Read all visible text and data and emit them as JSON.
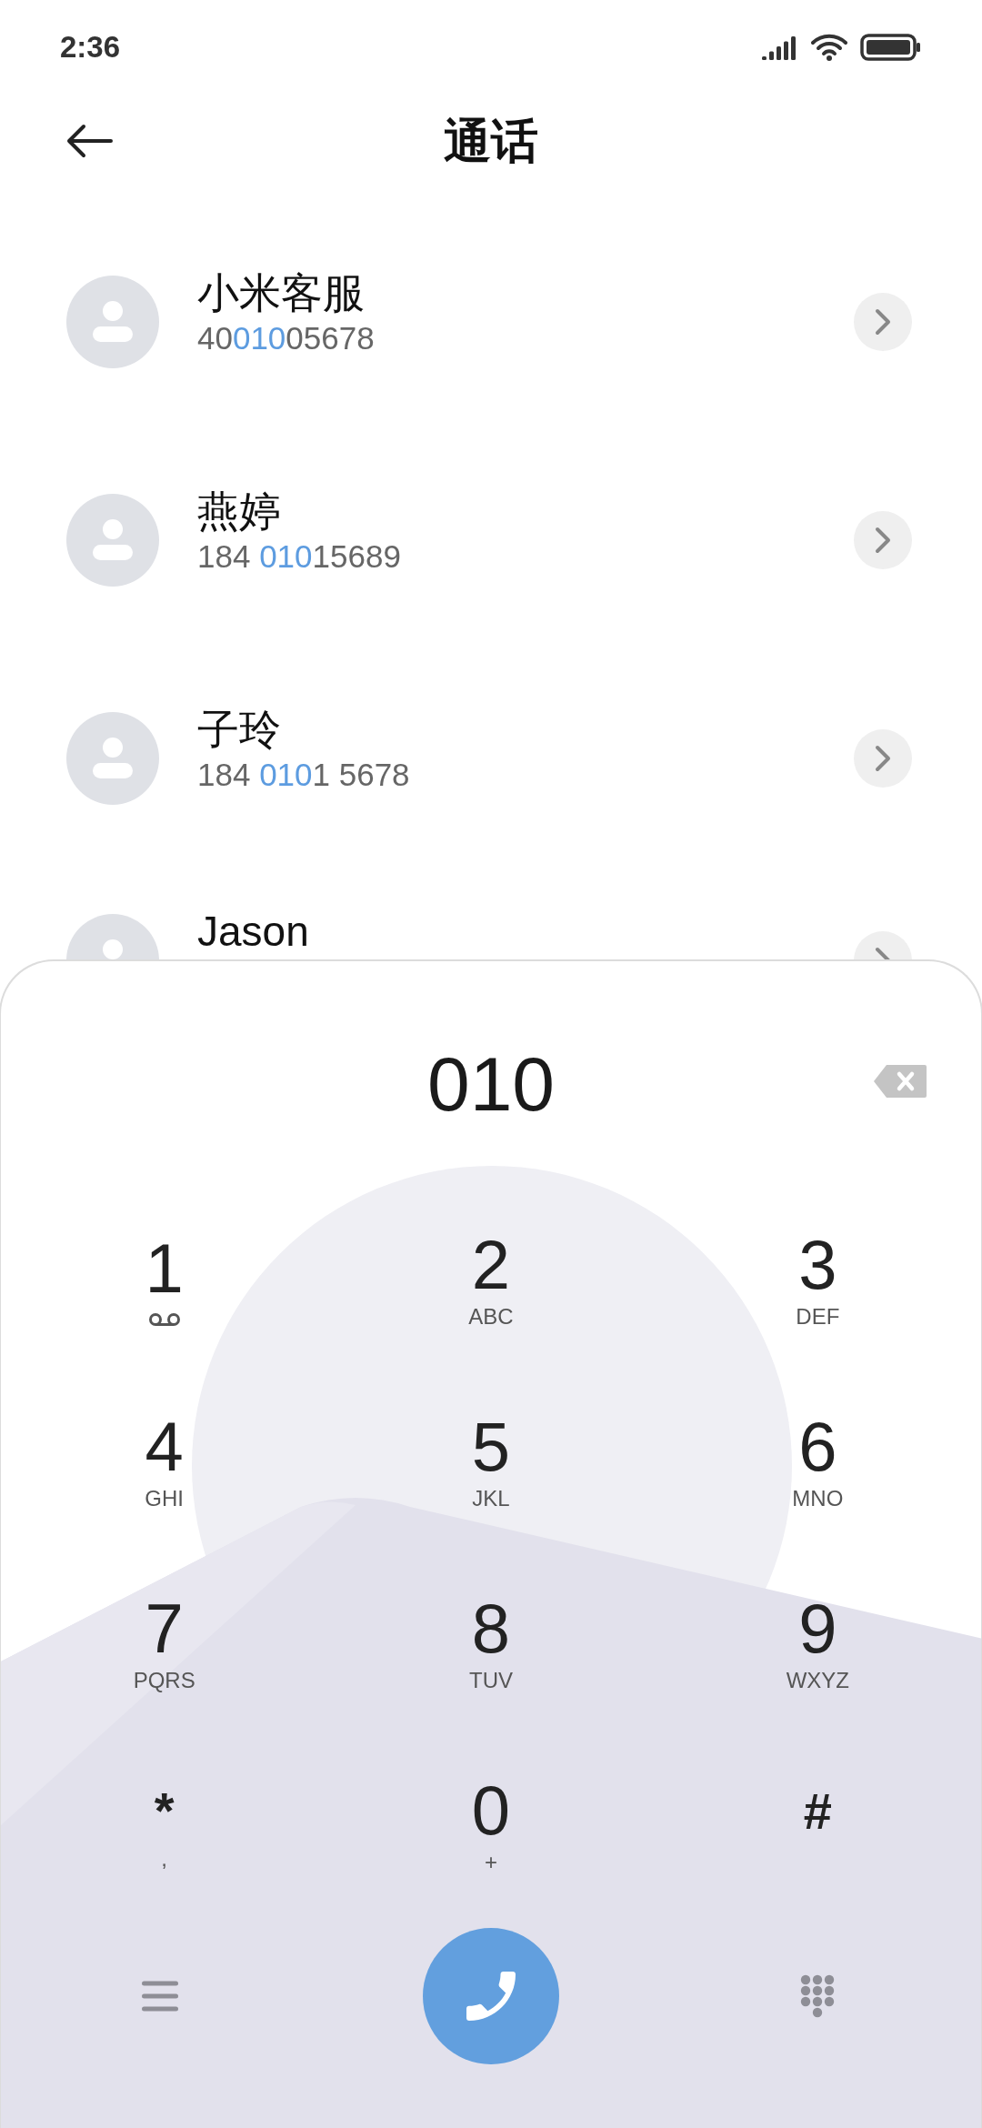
{
  "status_bar": {
    "time": "2:36"
  },
  "header": {
    "title": "通话"
  },
  "contacts": [
    {
      "name": "小米客服",
      "number": {
        "before": "40",
        "match": "010",
        "after": "05678"
      }
    },
    {
      "name": "燕婷",
      "number": {
        "before": "184 ",
        "match": "010",
        "after": "15689"
      }
    },
    {
      "name": "子玲",
      "number": {
        "before": "184 ",
        "match": "010",
        "after": "1 5678"
      }
    },
    {
      "name": "Jason"
    }
  ],
  "dialer": {
    "input": "010",
    "keys": [
      {
        "digit": "1",
        "kind": "voicemail"
      },
      {
        "digit": "2",
        "letters": "ABC"
      },
      {
        "digit": "3",
        "letters": "DEF"
      },
      {
        "digit": "4",
        "letters": "GHI"
      },
      {
        "digit": "5",
        "letters": "JKL"
      },
      {
        "digit": "6",
        "letters": "MNO"
      },
      {
        "digit": "7",
        "letters": "PQRS"
      },
      {
        "digit": "8",
        "letters": "TUV"
      },
      {
        "digit": "9",
        "letters": "WXYZ"
      },
      {
        "digit": "*",
        "letters": ",",
        "kind": "symbol"
      },
      {
        "digit": "0",
        "letters": "+"
      },
      {
        "digit": "#",
        "kind": "symbol"
      }
    ]
  }
}
